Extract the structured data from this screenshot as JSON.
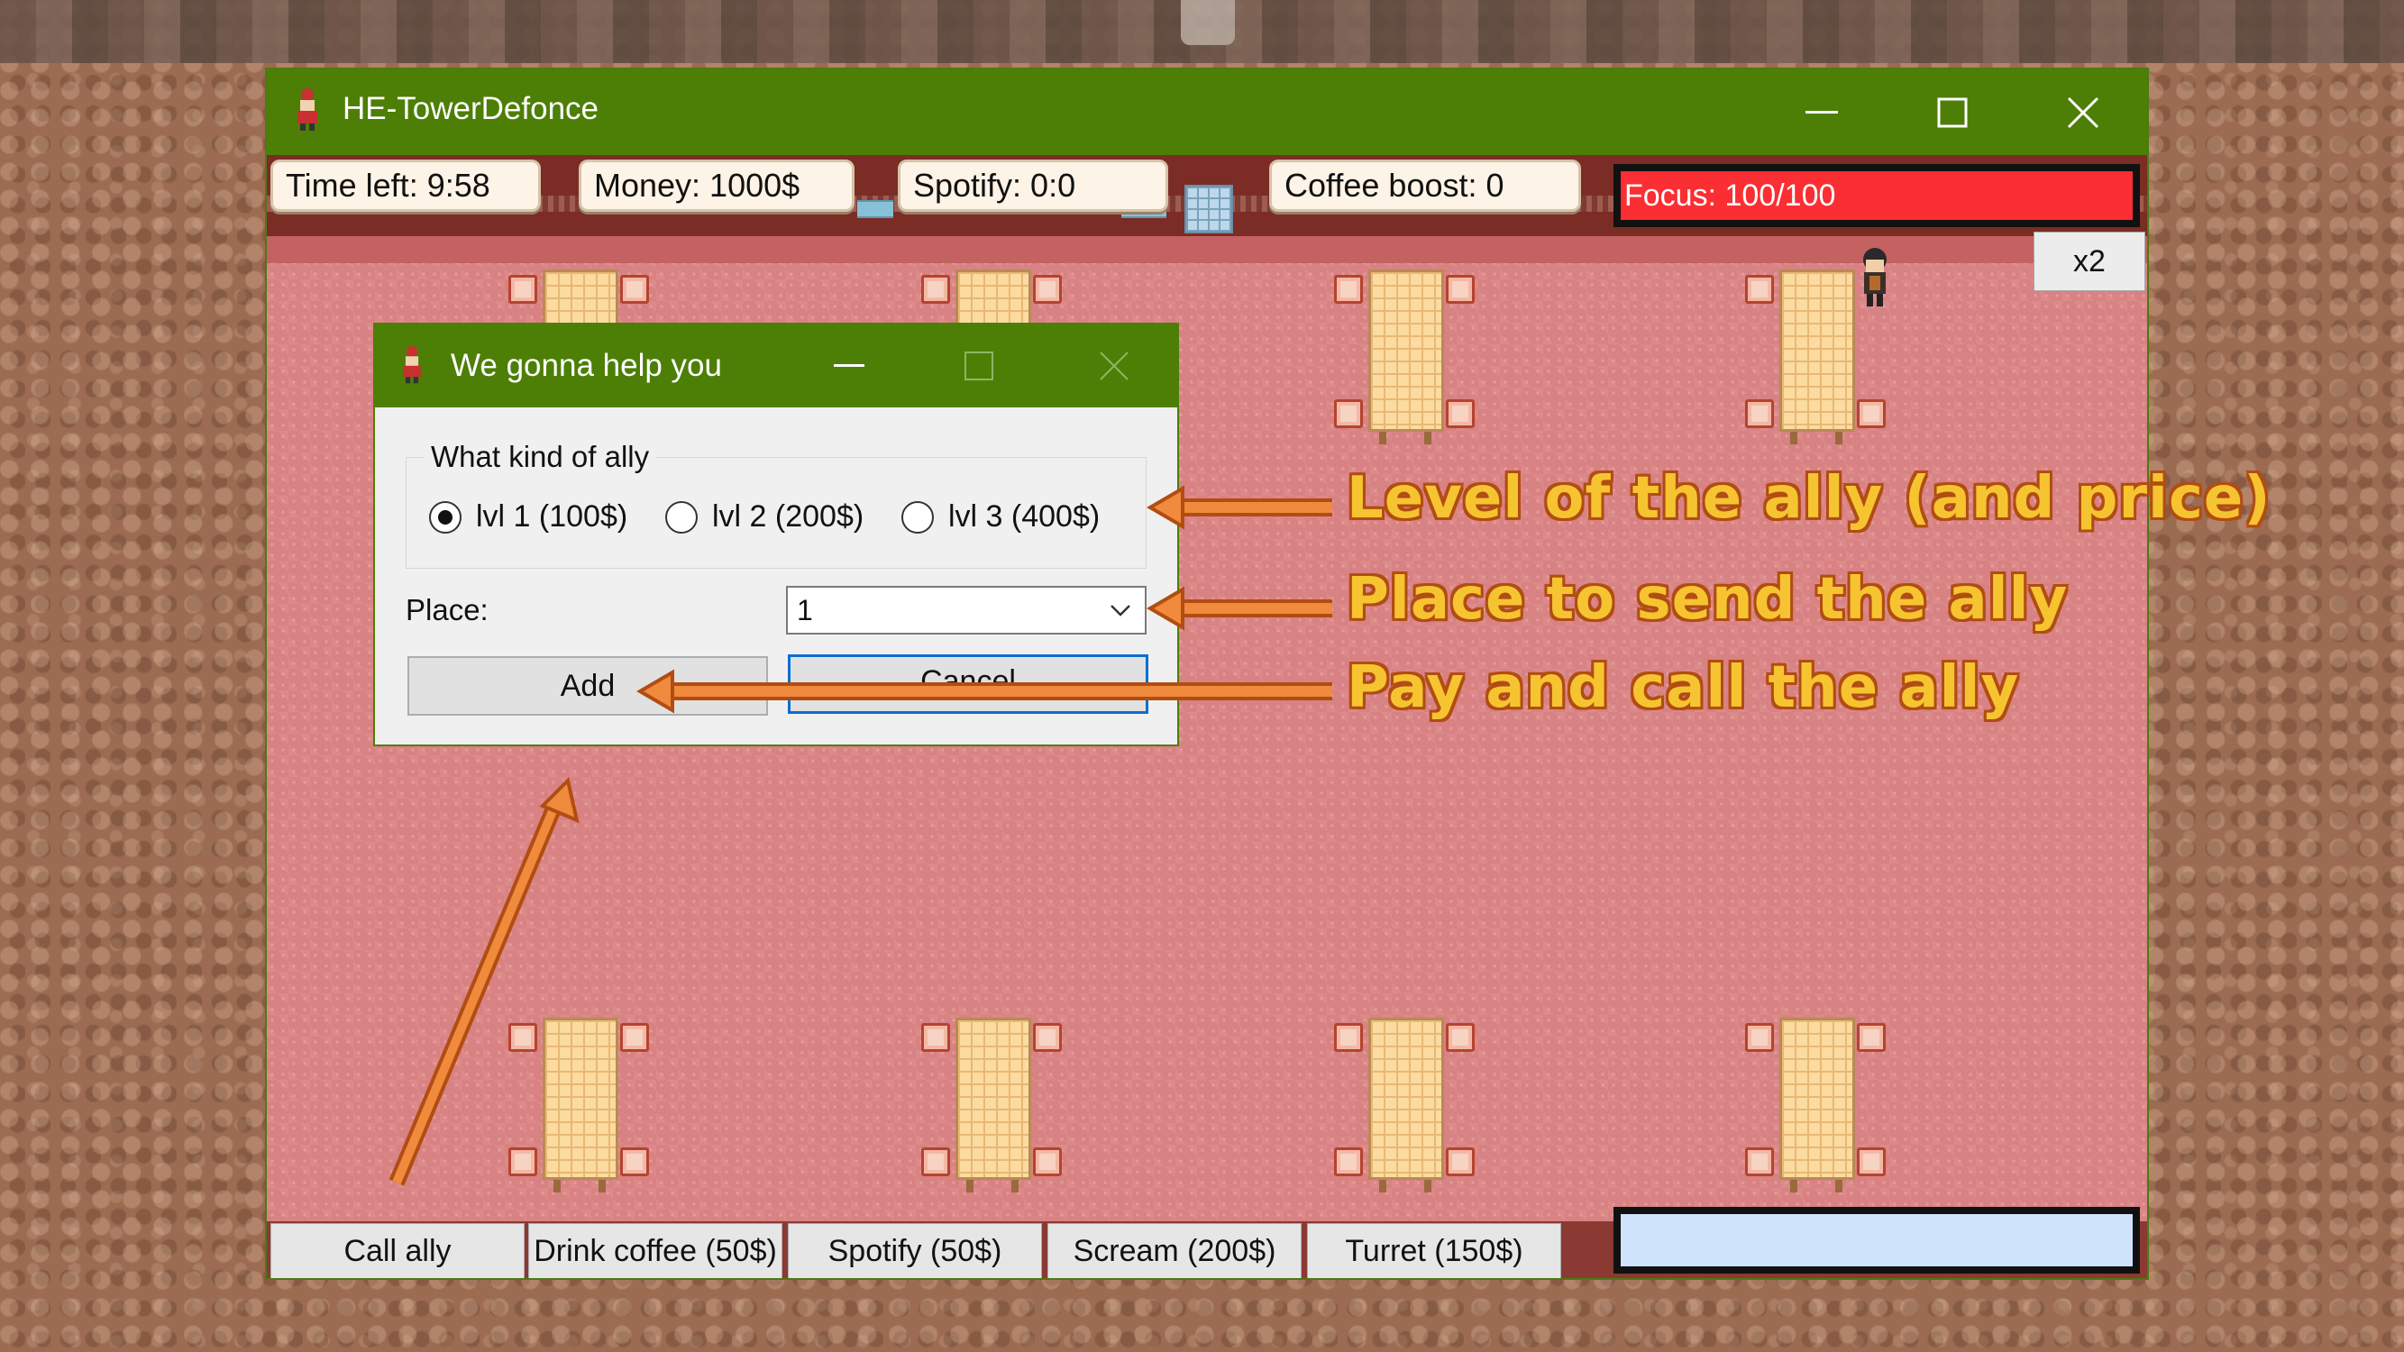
{
  "window": {
    "title": "HE-TowerDefonce"
  },
  "stats": {
    "time_left": "Time left: 9:58",
    "money": "Money: 1000$",
    "spotify": "Spotify: 0:0",
    "coffee_boost": "Coffee boost: 0",
    "focus": "Focus: 100/100"
  },
  "speed_button": "x2",
  "actions": [
    "Call ally",
    "Drink coffee (50$)",
    "Spotify (50$)",
    "Scream (200$)",
    "Turret (150$)"
  ],
  "dialog": {
    "title": "We gonna help you",
    "group_label": "What kind of ally",
    "options": [
      "lvl 1 (100$)",
      "lvl 2 (200$)",
      "lvl 3 (400$)"
    ],
    "selected_option": "lvl 1 (100$)",
    "place_label": "Place:",
    "place_value": "1",
    "add_label": "Add",
    "cancel_label": "Cancel"
  },
  "annotations": [
    "Level of the ally (and price)",
    "Place to send the ally",
    "Pay and call the ally"
  ],
  "colors": {
    "titlebar": "#4d7f06",
    "focus_bar": "#fb2e33",
    "annotation_text": "#f7c431",
    "arrow": "#f08a3c"
  }
}
